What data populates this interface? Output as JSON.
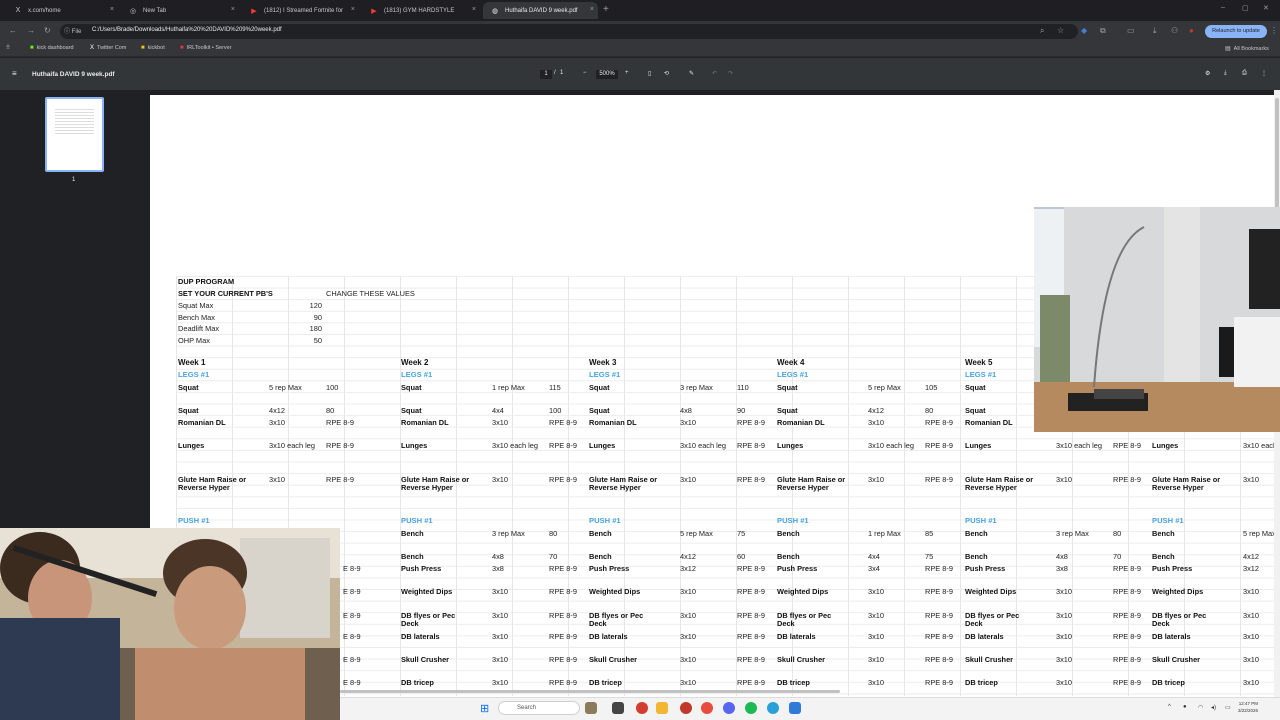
{
  "browser": {
    "tabs": [
      {
        "label": "x.com/home",
        "icon": "x-logo-icon",
        "close": "×"
      },
      {
        "label": "New Tab",
        "icon": "globe-icon",
        "close": "×"
      },
      {
        "label": "(1812) I Streamed Fortnite for",
        "icon": "youtube-icon",
        "close": "×"
      },
      {
        "label": "(1813) GYM HARDSTYLE",
        "icon": "youtube-icon",
        "close": "×"
      },
      {
        "label": "Huthaifa DAVID 9 week.pdf",
        "icon": "pdf-icon",
        "close": "×"
      }
    ],
    "new_tab": "+",
    "address": {
      "scheme_label": "File",
      "url": "C:/Users/Brade/Downloads/Huthaifa%20%20DAVID%209%20week.pdf"
    },
    "relaunch_label": "Relaunch to update",
    "bookmarks": [
      {
        "label": "kick dashboard",
        "icon": "kick-icon",
        "color": "#53fc18"
      },
      {
        "label": "Twitter Com",
        "icon": "x-logo-icon",
        "color": "#ffffff"
      },
      {
        "label": "kickbot",
        "icon": "bot-icon",
        "color": "#f5c518"
      },
      {
        "label": "IRLToolkit • Server",
        "icon": "irltoolkit-icon",
        "color": "#e53935"
      }
    ],
    "all_bookmarks": "All Bookmarks"
  },
  "pdf": {
    "title": "Huthaifa DAVID 9 week.pdf",
    "page_current": "1",
    "page_sep": "/",
    "page_total": "1",
    "zoom": "500%",
    "thumb_number": "1"
  },
  "sheet": {
    "header": {
      "program": "DUP PROGRAM",
      "set_pbs": "SET YOUR CURRENT PB'S",
      "change_values": "CHANGE THESE VALUES",
      "maxes": [
        {
          "label": "Squat Max",
          "value": "120"
        },
        {
          "label": "Bench Max",
          "value": "90"
        },
        {
          "label": "Deadlift Max",
          "value": "180"
        },
        {
          "label": "OHP Max",
          "value": "50"
        }
      ]
    },
    "weeks": [
      "Week 1",
      "Week 2",
      "Week 3",
      "Week 4",
      "Week 5"
    ],
    "legs_label": "LEGS #1",
    "push_label": "PUSH #1",
    "cols": [
      {
        "legs": [
          [
            "Squat",
            "5 rep Max",
            "100"
          ],
          [
            "Squat",
            "4x12",
            "80"
          ],
          [
            "Romanian DL",
            "3x10",
            "RPE 8-9"
          ],
          [
            "Lunges",
            "3x10 each leg",
            "RPE 8-9"
          ],
          [
            "Glute Ham Raise or Reverse Hyper",
            "3x10",
            "RPE 8-9"
          ]
        ],
        "push": [
          [
            "",
            "",
            ""
          ],
          [
            "",
            "",
            ""
          ],
          [
            "",
            "",
            "E 8-9"
          ],
          [
            "",
            "",
            "E 8-9"
          ],
          [
            "",
            "",
            "E 8-9"
          ],
          [
            "",
            "",
            "E 8-9"
          ],
          [
            "",
            "",
            "E 8-9"
          ],
          [
            "",
            "",
            "E 8-9"
          ]
        ]
      },
      {
        "legs": [
          [
            "Squat",
            "1 rep Max",
            "115"
          ],
          [
            "Squat",
            "4x4",
            "100"
          ],
          [
            "Romanian DL",
            "3x10",
            "RPE 8-9"
          ],
          [
            "Lunges",
            "3x10 each leg",
            "RPE 8-9"
          ],
          [
            "Glute Ham Raise or Reverse Hyper",
            "3x10",
            "RPE 8-9"
          ]
        ],
        "push": [
          [
            "Bench",
            "3 rep Max",
            "80"
          ],
          [
            "Bench",
            "4x8",
            "70"
          ],
          [
            "Push Press",
            "3x8",
            "RPE 8-9"
          ],
          [
            "Weighted Dips",
            "3x10",
            "RPE 8-9"
          ],
          [
            "DB flyes or Pec Deck",
            "3x10",
            "RPE 8-9"
          ],
          [
            "DB laterals",
            "3x10",
            "RPE 8-9"
          ],
          [
            "Skull Crusher",
            "3x10",
            "RPE 8-9"
          ],
          [
            "DB tricep",
            "3x10",
            "RPE 8-9"
          ]
        ]
      },
      {
        "legs": [
          [
            "Squat",
            "3 rep Max",
            "110"
          ],
          [
            "Squat",
            "4x8",
            "90"
          ],
          [
            "Romanian DL",
            "3x10",
            "RPE 8-9"
          ],
          [
            "Lunges",
            "3x10 each leg",
            "RPE 8-9"
          ],
          [
            "Glute Ham Raise or Reverse Hyper",
            "3x10",
            "RPE 8-9"
          ]
        ],
        "push": [
          [
            "Bench",
            "5 rep Max",
            "75"
          ],
          [
            "Bench",
            "4x12",
            "60"
          ],
          [
            "Push Press",
            "3x12",
            "RPE 8-9"
          ],
          [
            "Weighted Dips",
            "3x10",
            "RPE 8-9"
          ],
          [
            "DB flyes or Pec Deck",
            "3x10",
            "RPE 8-9"
          ],
          [
            "DB laterals",
            "3x10",
            "RPE 8-9"
          ],
          [
            "Skull Crusher",
            "3x10",
            "RPE 8-9"
          ],
          [
            "DB tricep",
            "3x10",
            "RPE 8-9"
          ]
        ]
      },
      {
        "legs": [
          [
            "Squat",
            "5 rep Max",
            "105"
          ],
          [
            "Squat",
            "4x12",
            "80"
          ],
          [
            "Romanian DL",
            "3x10",
            "RPE 8-9"
          ],
          [
            "Lunges",
            "3x10 each leg",
            "RPE 8-9"
          ],
          [
            "Glute Ham Raise or Reverse Hyper",
            "3x10",
            "RPE 8-9"
          ]
        ],
        "push": [
          [
            "Bench",
            "1 rep Max",
            "85"
          ],
          [
            "Bench",
            "4x4",
            "75"
          ],
          [
            "Push Press",
            "3x4",
            "RPE 8-9"
          ],
          [
            "Weighted Dips",
            "3x10",
            "RPE 8-9"
          ],
          [
            "DB flyes or Pec Deck",
            "3x10",
            "RPE 8-9"
          ],
          [
            "DB laterals",
            "3x10",
            "RPE 8-9"
          ],
          [
            "Skull Crusher",
            "3x10",
            "RPE 8-9"
          ],
          [
            "DB tricep",
            "3x10",
            "RPE 8-9"
          ]
        ]
      },
      {
        "legs": [
          [
            "Squat",
            "1 re",
            ""
          ],
          [
            "Squat",
            "4x4",
            ""
          ],
          [
            "Romanian DL",
            "3x1",
            ""
          ],
          [
            "Lunges",
            "3x10 each leg",
            "RPE 8-9"
          ],
          [
            "Glute Ham Raise or Reverse Hyper",
            "3x10",
            "RPE 8-9"
          ]
        ],
        "push": [
          [
            "Bench",
            "3 rep Max",
            "80"
          ],
          [
            "Bench",
            "4x8",
            "70"
          ],
          [
            "Push Press",
            "3x8",
            "RPE 8-9"
          ],
          [
            "Weighted Dips",
            "3x10",
            "RPE 8-9"
          ],
          [
            "DB flyes or Pec Deck",
            "3x10",
            "RPE 8-9"
          ],
          [
            "DB laterals",
            "3x10",
            "RPE 8-9"
          ],
          [
            "Skull Crusher",
            "3x10",
            "RPE 8-9"
          ],
          [
            "DB tricep",
            "3x10",
            "RPE 8-9"
          ]
        ]
      },
      {
        "legs": [
          [
            "",
            "",
            ""
          ],
          [
            "",
            "",
            ""
          ],
          [
            "",
            "",
            ""
          ],
          [
            "Lunges",
            "3x10 each leg",
            "RI"
          ],
          [
            "Glute Ham Raise or Reverse Hyper",
            "3x10",
            ""
          ]
        ],
        "push": [
          [
            "Bench",
            "5 rep Max",
            "60"
          ],
          [
            "Bench",
            "4x12",
            "60"
          ],
          [
            "Push Press",
            "3x12",
            "RI"
          ],
          [
            "Weighted Dips",
            "3x10",
            "RI"
          ],
          [
            "DB flyes or Pec Deck",
            "3x10",
            "RI"
          ],
          [
            "DB laterals",
            "3x10",
            "RI"
          ],
          [
            "Skull Crusher",
            "3x10",
            "RI"
          ],
          [
            "DB tricep",
            "3x10",
            "RI"
          ]
        ]
      }
    ]
  },
  "taskbar": {
    "search_placeholder": "Search",
    "time": "12:47 PM",
    "date": "3/22/2026"
  },
  "colors": {
    "section_blue": "#4aa3df",
    "accent": "#8ab4f8"
  }
}
